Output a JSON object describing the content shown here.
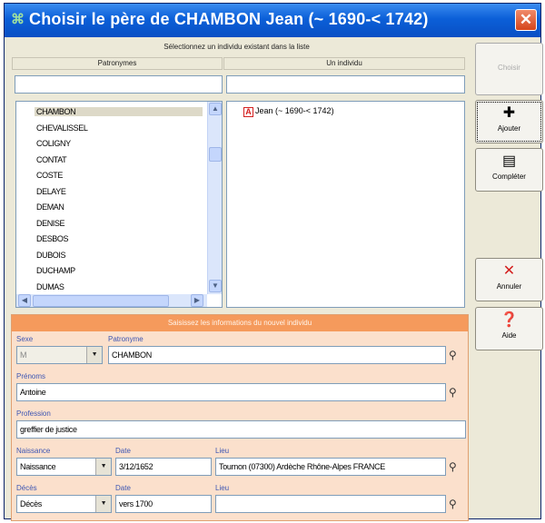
{
  "window": {
    "title": "Choisir le père de CHAMBON Jean (~ 1690-< 1742)",
    "close": "✕"
  },
  "selection": {
    "hint": "Sélectionnez un individu existant dans la liste",
    "surnames_header": "Patronymes",
    "individuals_header": "Un individu",
    "surnames": [
      "CHAMBON",
      "CHEVALISSEL",
      "COLIGNY",
      "CONTAT",
      "COSTE",
      "DELAYE",
      "DEMAN",
      "DENISE",
      "DESBOS",
      "DUBOIS",
      "DUCHAMP",
      "DUMAS"
    ],
    "selected_surname": "CHAMBON",
    "individuals": [
      {
        "icon": "A",
        "label": "Jean (~ 1690-< 1742)"
      }
    ]
  },
  "buttons": {
    "choose": "Choisir",
    "add": "Ajouter",
    "complete": "Compléter",
    "cancel": "Annuler",
    "help": "Aide"
  },
  "form": {
    "header": "Saisissez les informations du nouvel individu",
    "sexe_label": "Sexe",
    "sexe_value": "M",
    "patronyme_label": "Patronyme",
    "patronyme_value": "CHAMBON",
    "prenoms_label": "Prénoms",
    "prenoms_value": "Antoine",
    "profession_label": "Profession",
    "profession_value": "greffier de justice",
    "naissance_label": "Naissance",
    "naissance_value": "Naissance",
    "naissance_date_label": "Date",
    "naissance_date": "3/12/1652",
    "naissance_lieu_label": "Lieu",
    "naissance_lieu": "Tournon (07300) Ardèche Rhône-Alpes FRANCE",
    "deces_label": "Décès",
    "deces_value": "Décès",
    "deces_date_label": "Date",
    "deces_date": "vers 1700",
    "deces_lieu_label": "Lieu",
    "deces_lieu": ""
  },
  "colors": {
    "title_bar": "#0b5fd8",
    "form_bg": "#fbe0cc",
    "form_header": "#f59a5c",
    "label_blue": "#3d56b3"
  }
}
